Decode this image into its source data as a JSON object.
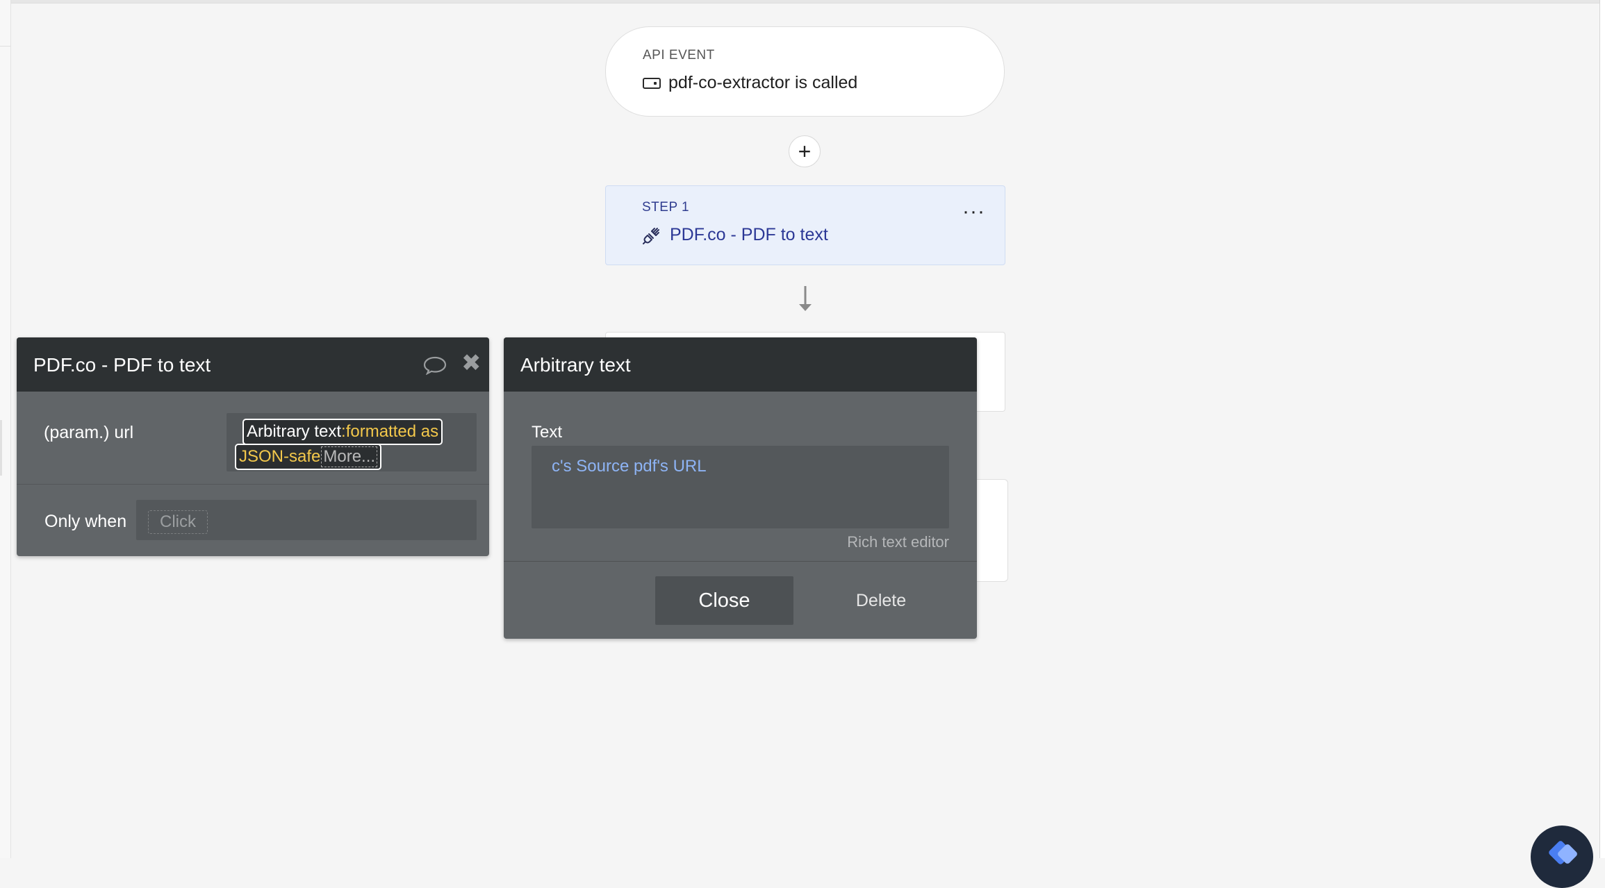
{
  "workflow": {
    "event": {
      "label": "API EVENT",
      "title": "pdf-co-extractor is called",
      "icon": "api-event-icon"
    },
    "add_step_symbol": "+",
    "step1": {
      "label": "STEP 1",
      "title": "PDF.co - PDF to text",
      "icon": "plug-icon",
      "menu_symbol": "···"
    }
  },
  "property_panel": {
    "title": "PDF.co - PDF to text",
    "param_label": "(param.) url",
    "expression": {
      "chip1_white": "Arbitrary text",
      "chip1_yellow": ":formatted as",
      "chip2_yellow": "JSON-safe",
      "chip2_more": "More..."
    },
    "only_when_label": "Only when",
    "only_when_placeholder": "Click",
    "close_symbol": "✖"
  },
  "arbitrary_text_popup": {
    "title": "Arbitrary text",
    "text_label": "Text",
    "text_value": "c's Source pdf's URL",
    "rich_text_link": "Rich text editor",
    "close_label": "Close",
    "delete_label": "Delete"
  },
  "colors": {
    "step_bg": "#eaf0fb",
    "step_text": "#2c3896",
    "panel_bg": "#616568",
    "panel_header": "#2d3133",
    "dynamic_yellow": "#f3c84b",
    "dynamic_blue": "#8eb4f5"
  }
}
